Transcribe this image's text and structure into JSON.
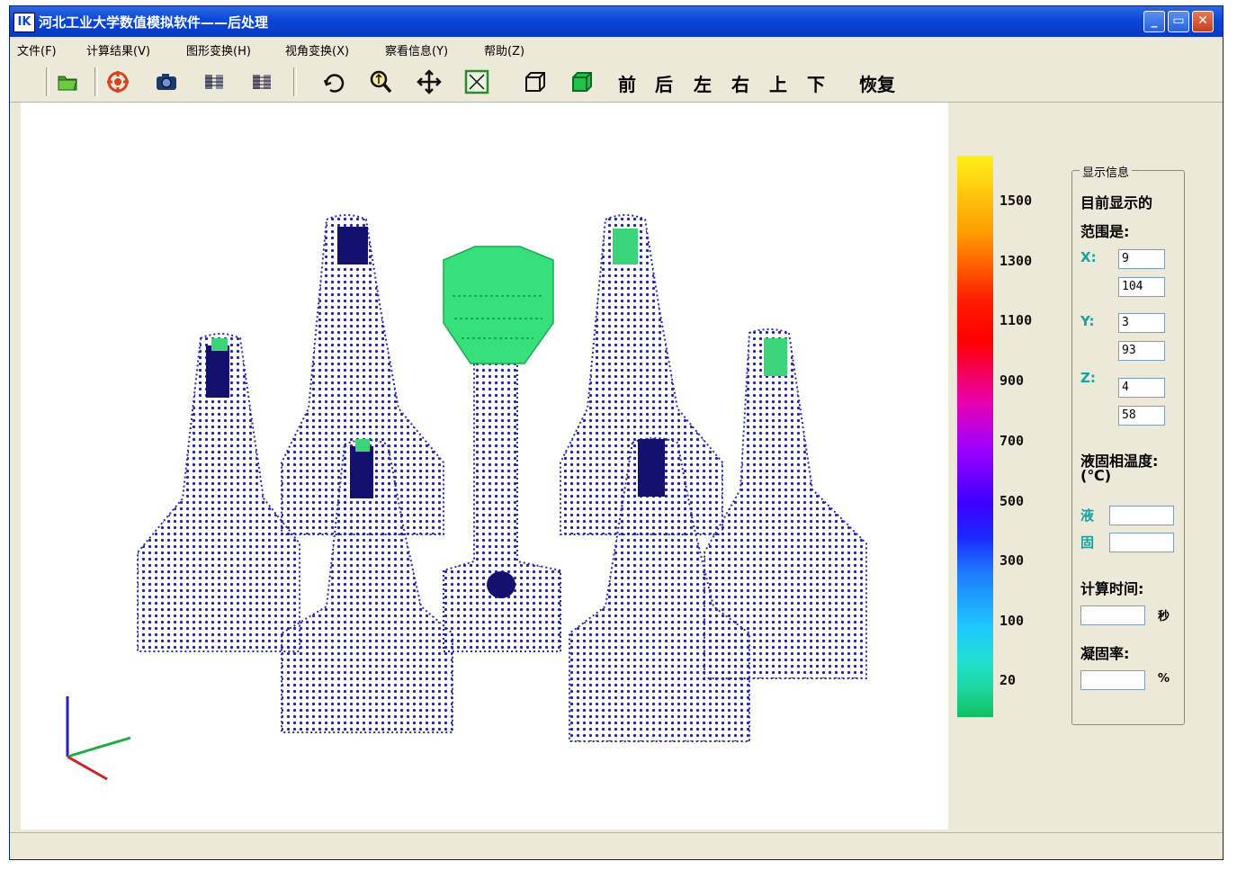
{
  "window": {
    "logo": "IK",
    "title": "河北工业大学数值模拟软件——后处理",
    "minimize": "_",
    "restore": "▭",
    "close": "✕"
  },
  "menu": {
    "file": "文件(F)",
    "results": "计算结果(V)",
    "graphics": "图形变换(H)",
    "view": "视角变换(X)",
    "info": "察看信息(Y)",
    "help": "帮助(Z)"
  },
  "toolbar": {
    "front": "前",
    "back": "后",
    "left": "左",
    "right": "右",
    "top": "上",
    "bottom": "下",
    "restore": "恢复"
  },
  "colorbar": {
    "labels": [
      "1500",
      "1300",
      "1100",
      "900",
      "700",
      "500",
      "300",
      "100",
      "20"
    ]
  },
  "panel": {
    "group_title": "显示信息",
    "range_title_1": "目前显示的",
    "range_title_2": "范围是:",
    "x_label": "X:",
    "x_min": "9",
    "x_max": "104",
    "y_label": "Y:",
    "y_min": "3",
    "y_max": "93",
    "z_label": "Z:",
    "z_min": "4",
    "z_max": "58",
    "temp_title": "液固相温度:",
    "temp_unit": "(℃)",
    "liquid_label": "液",
    "solid_label": "固",
    "time_title": "计算时间:",
    "time_unit": "秒",
    "solid_rate_title": "凝固率:",
    "rate_unit": "%"
  }
}
